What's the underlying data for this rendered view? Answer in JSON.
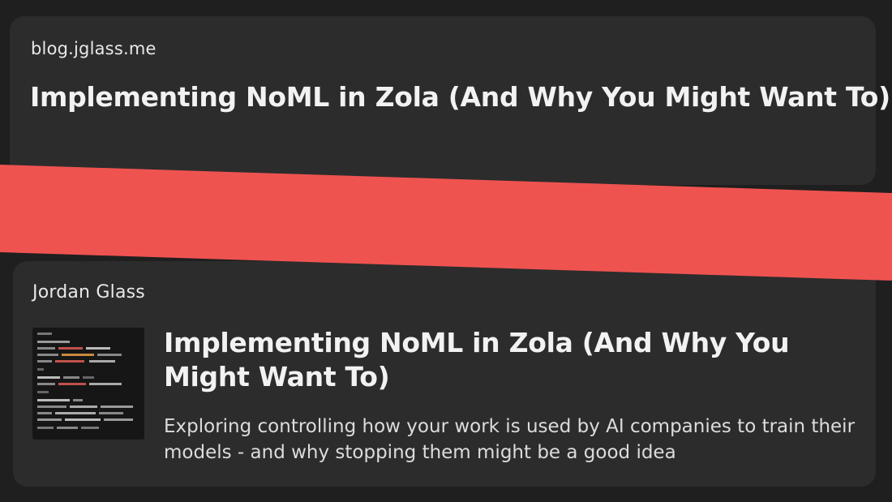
{
  "card_top": {
    "site": "blog.jglass.me",
    "title": "Implementing NoML in Zola (And Why You Might Want To)"
  },
  "card_bottom": {
    "author": "Jordan Glass",
    "title": "Implementing NoML in Zola (And Why You Might Want To)",
    "description": "Exploring controlling how your work is used by AI companies to train their models - and why stopping them might be a good idea",
    "thumbnail_icon": "code-screenshot-thumbnail"
  },
  "colors": {
    "background": "#1f1f1f",
    "card": "#2c2c2c",
    "stripe": "#ef5350",
    "text": "#f2f2f2"
  }
}
